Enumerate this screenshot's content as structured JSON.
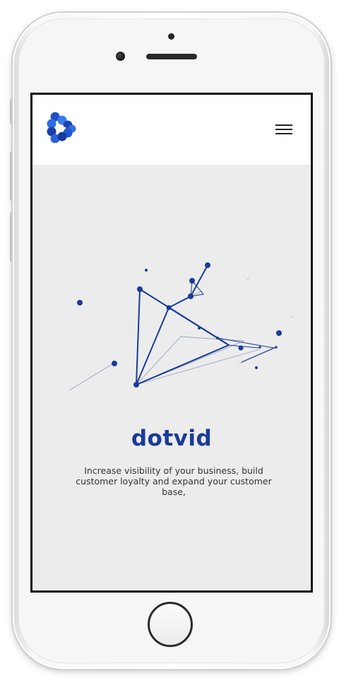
{
  "app": {
    "brand_name": "dotvid",
    "tagline": "Increase visibility of your business, build customer loyalty and expand your customer base,"
  },
  "header": {
    "logo_icon": "dotvid-logo-icon",
    "menu_icon": "hamburger-menu-icon"
  },
  "hero": {
    "illustration": "constellation-play-icon"
  },
  "colors": {
    "brand_blue": "#1a3b9a",
    "page_background": "#ececec",
    "header_background": "#ffffff",
    "line_grey": "#9aa3b8"
  }
}
